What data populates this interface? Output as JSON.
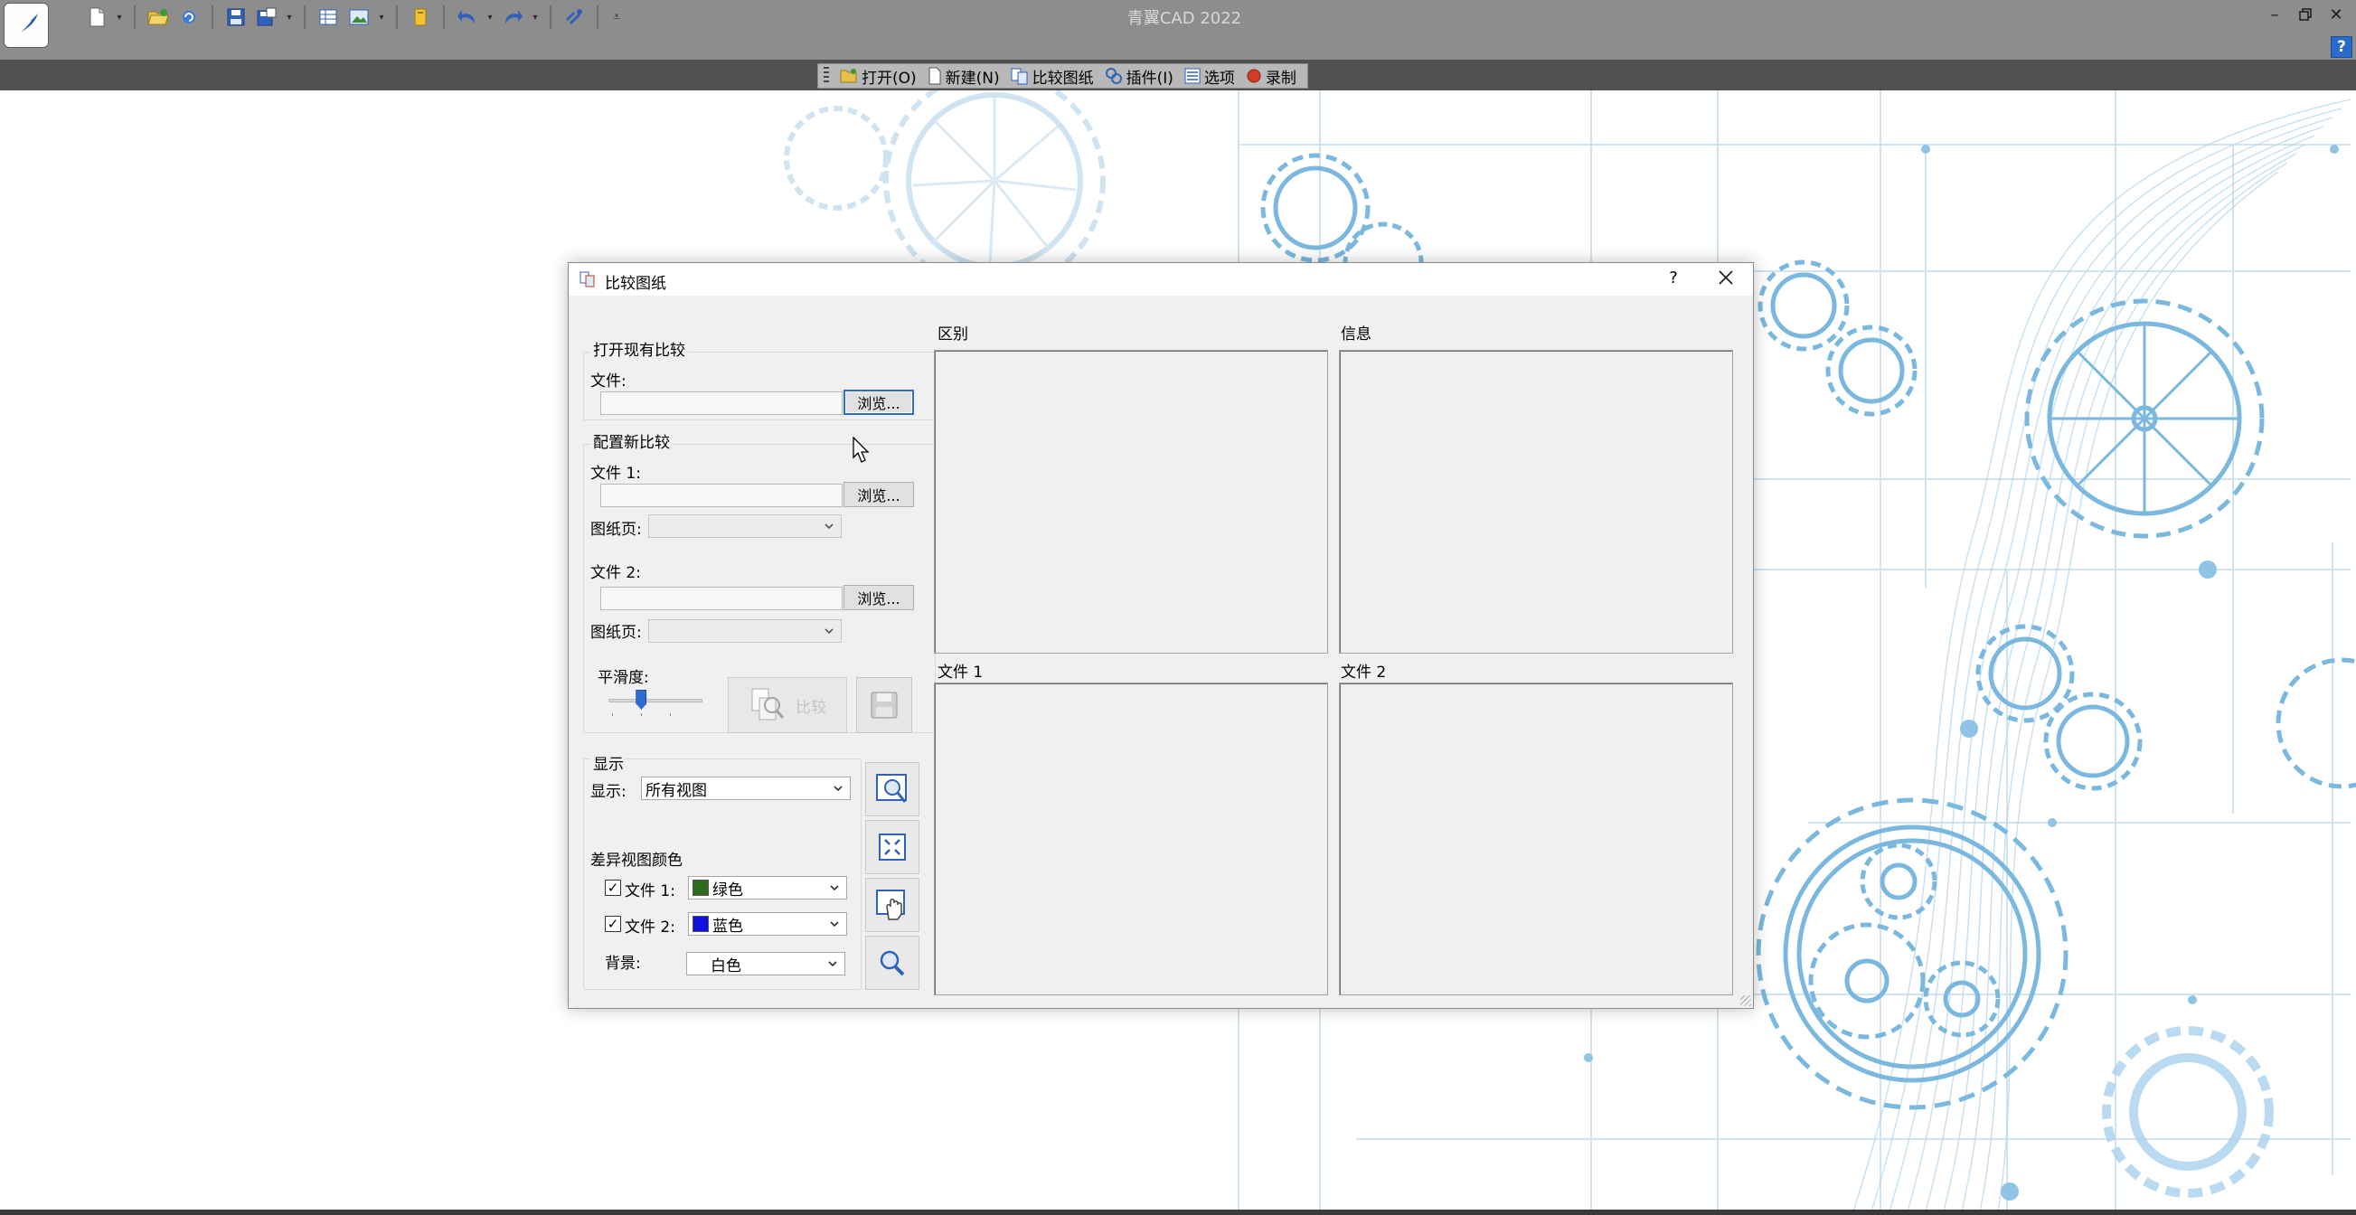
{
  "app": {
    "title": "青翼CAD 2022",
    "help_label": "?",
    "window_controls": [
      "minimize-icon",
      "restore-icon",
      "close-icon"
    ]
  },
  "quick_access": [
    "new-file-icon",
    "open-folder-icon",
    "refresh-icon",
    "save-icon",
    "save-as-icon",
    "table-icon",
    "image-icon",
    "folder-icon",
    "undo-icon",
    "redo-icon",
    "link-icon",
    "customize-icon"
  ],
  "doc_toolbar": {
    "items": [
      {
        "icon": "open-folder-icon",
        "label": "打开(O)"
      },
      {
        "icon": "new-file-icon",
        "label": "新建(N)"
      },
      {
        "icon": "compare-drawings-icon",
        "label": "比较图纸"
      },
      {
        "icon": "plugin-icon",
        "label": "插件(I)"
      },
      {
        "icon": "options-icon",
        "label": "选项"
      },
      {
        "icon": "record-icon",
        "label": "录制"
      }
    ]
  },
  "dialog": {
    "title": "比较图纸",
    "help": "?",
    "open_existing": {
      "group_label": "打开现有比较",
      "file_label": "文件:",
      "file_value": "",
      "browse_label": "浏览..."
    },
    "configure_new": {
      "group_label": "配置新比较",
      "file1_label": "文件 1:",
      "file1_value": "",
      "browse1_label": "浏览...",
      "sheet1_label": "图纸页:",
      "sheet1_value": "",
      "file2_label": "文件 2:",
      "file2_value": "",
      "browse2_label": "浏览...",
      "sheet2_label": "图纸页:",
      "sheet2_value": "",
      "smoothness_label": "平滑度:",
      "smoothness_level": 0.33,
      "compare_label": "比较"
    },
    "display": {
      "group_label": "显示",
      "display_label": "显示:",
      "display_value": "所有视图",
      "diff_colors_label": "差异视图颜色",
      "file1_check_label": "文件 1:",
      "file1_checked": true,
      "file1_color": "绿色",
      "file1_swatch": "#2e6b1f",
      "file2_check_label": "文件 2:",
      "file2_checked": true,
      "file2_color": "蓝色",
      "file2_swatch": "#1010e0",
      "background_label": "背景:",
      "background_value": "白色"
    },
    "panels": {
      "difference": "区别",
      "info": "信息",
      "file1": "文件 1",
      "file2": "文件 2"
    },
    "side_buttons": [
      "zoom-window-icon",
      "zoom-extents-icon",
      "pan-hand-icon",
      "zoom-realtime-icon"
    ]
  }
}
